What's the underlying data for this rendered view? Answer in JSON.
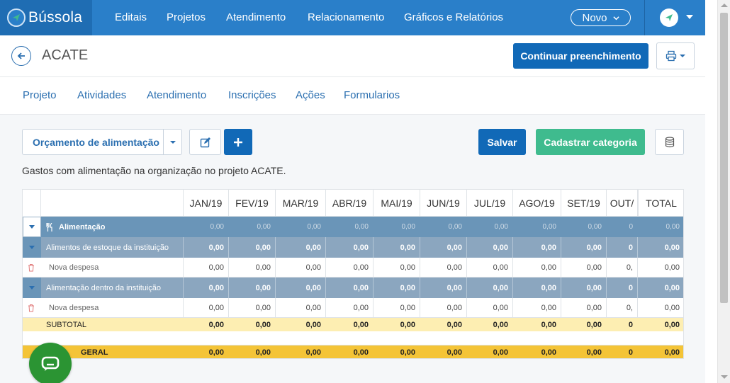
{
  "nav": {
    "brand": "Bússola",
    "items": [
      "Editais",
      "Projetos",
      "Atendimento",
      "Relacionamento",
      "Gráficos e Relatórios"
    ],
    "novo_label": "Novo"
  },
  "header": {
    "title": "ACATE",
    "continue_label": "Continuar preenchimento"
  },
  "subtabs": [
    "Projeto",
    "Atividades",
    "Atendimento",
    "Inscrições",
    "Ações",
    "Formularios"
  ],
  "toolbar": {
    "budget_select": "Orçamento de alimentação",
    "save_label": "Salvar",
    "category_label": "Cadastrar categoria"
  },
  "description": "Gastos com alimentação na organização no projeto ACATE.",
  "table": {
    "months": [
      "JAN/19",
      "FEV/19",
      "MAR/19",
      "ABR/19",
      "MAI/19",
      "JUN/19",
      "JUL/19",
      "AGO/19",
      "SET/19",
      "OUT/"
    ],
    "total_header": "TOTAL",
    "group": {
      "label": "Alimentação",
      "values": [
        "0,00",
        "0,00",
        "0,00",
        "0,00",
        "0,00",
        "0,00",
        "0,00",
        "0,00",
        "0,00",
        "0",
        "0,00"
      ]
    },
    "subcategories": [
      {
        "label": "Alimentos de estoque da instituição",
        "values": [
          "0,00",
          "0,00",
          "0,00",
          "0,00",
          "0,00",
          "0,00",
          "0,00",
          "0,00",
          "0,00",
          "0",
          "0,00"
        ],
        "expense": {
          "label": "Nova despesa",
          "values": [
            "0,00",
            "0,00",
            "0,00",
            "0,00",
            "0,00",
            "0,00",
            "0,00",
            "0,00",
            "0,00",
            "0,",
            "0,00"
          ]
        }
      },
      {
        "label": "Alimentação dentro da instituição",
        "values": [
          "0,00",
          "0,00",
          "0,00",
          "0,00",
          "0,00",
          "0,00",
          "0,00",
          "0,00",
          "0,00",
          "0",
          "0,00"
        ],
        "expense": {
          "label": "Nova despesa",
          "values": [
            "0,00",
            "0,00",
            "0,00",
            "0,00",
            "0,00",
            "0,00",
            "0,00",
            "0,00",
            "0,00",
            "0,",
            "0,00"
          ]
        }
      }
    ],
    "subtotal": {
      "label": "SUBTOTAL",
      "values": [
        "0,00",
        "0,00",
        "0,00",
        "0,00",
        "0,00",
        "0,00",
        "0,00",
        "0,00",
        "0,00",
        "0",
        "0,00"
      ]
    },
    "grand_total": {
      "label": "GERAL",
      "values": [
        "0,00",
        "0,00",
        "0,00",
        "0,00",
        "0,00",
        "0,00",
        "0,00",
        "0,00",
        "0,00",
        "0",
        "0,00"
      ]
    }
  },
  "colors": {
    "nav_bg": "#2a7fc9",
    "primary": "#1169b7",
    "success": "#3fbb8e",
    "group_row": "#6a95b8",
    "sub_row": "#8ba6bf",
    "subtotal_row": "#fdeeb2",
    "grand_total_row": "#f4c437",
    "chat": "#2b9433"
  },
  "icons": [
    "compass-logo-icon",
    "chevron-down-icon",
    "back-arrow-icon",
    "printer-icon",
    "edit-icon",
    "plus-icon",
    "database-icon",
    "utensils-icon",
    "trash-icon",
    "chat-icon"
  ]
}
